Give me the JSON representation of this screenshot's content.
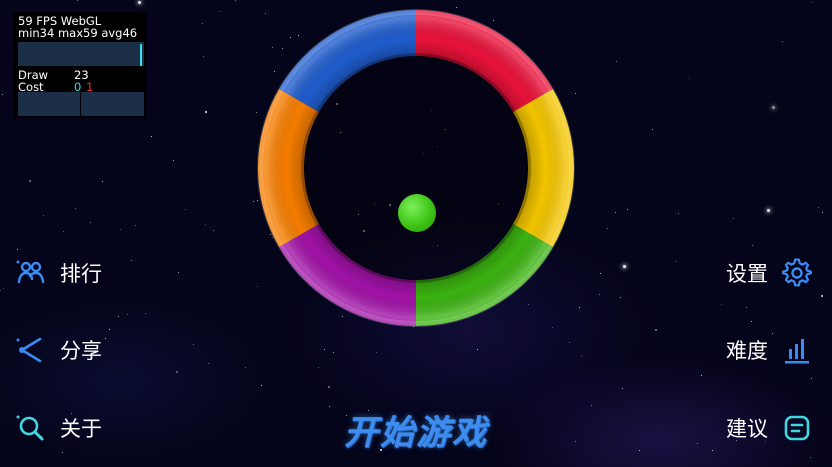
{
  "fps_panel": {
    "line1": "59 FPS WebGL",
    "line2": "min34 max59 avg46",
    "draw_label": "Draw",
    "draw_value": "23",
    "cost_label": "Cost",
    "cost_value_a": "0",
    "cost_value_b": "1"
  },
  "ring": {
    "segments": [
      {
        "color": "red",
        "hex": "#e8123a"
      },
      {
        "color": "yellow",
        "hex": "#f2c400"
      },
      {
        "color": "green",
        "hex": "#3bb211"
      },
      {
        "color": "purple",
        "hex": "#a012a6"
      },
      {
        "color": "orange",
        "hex": "#f57d00"
      },
      {
        "color": "blue",
        "hex": "#1f5ccc"
      }
    ],
    "ball_color": "#3cc415"
  },
  "menu": {
    "left": [
      {
        "label": "排行",
        "icon": "users-icon"
      },
      {
        "label": "分享",
        "icon": "share-icon"
      },
      {
        "label": "关于",
        "icon": "search-icon"
      }
    ],
    "right": [
      {
        "label": "设置",
        "icon": "gear-icon"
      },
      {
        "label": "难度",
        "icon": "bar-chart-icon"
      },
      {
        "label": "建议",
        "icon": "feedback-icon"
      }
    ]
  },
  "start_button": {
    "label": "开始游戏"
  },
  "colors": {
    "menu_icon": "#3a8cf5",
    "start_text": "#3f8cf0",
    "background": "#04041a"
  }
}
